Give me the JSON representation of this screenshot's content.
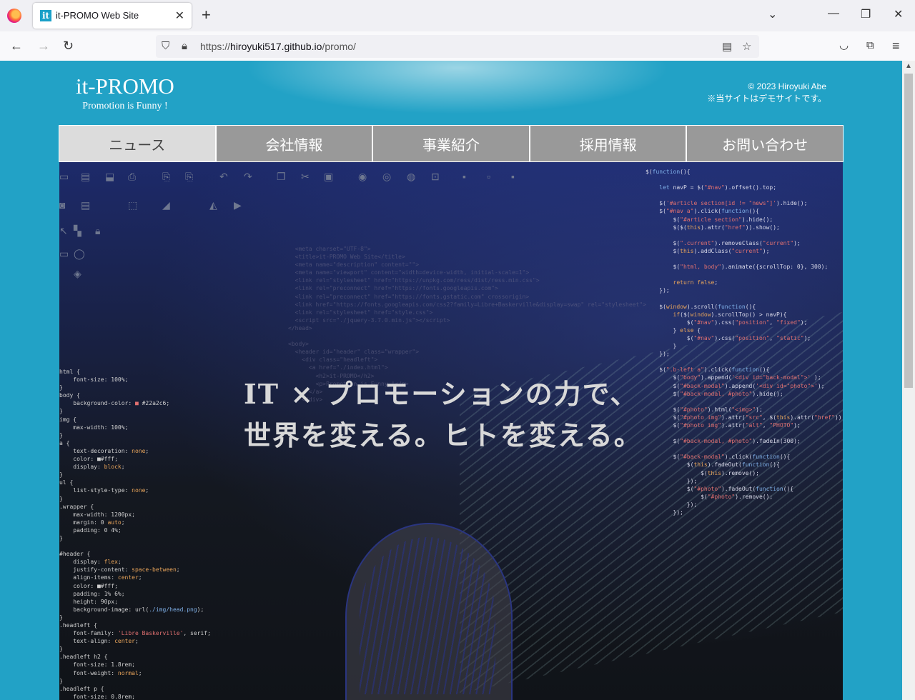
{
  "browser": {
    "tab_title": "it-PROMO Web Site",
    "tab_favicon": "it",
    "url_scheme": "https://",
    "url_host": "hiroyuki517.github.io",
    "url_path": "/promo/",
    "icons": {
      "back": "arrow-left-icon",
      "forward": "arrow-right-icon",
      "reload": "reload-icon",
      "shield": "shield-icon",
      "lock": "lock-icon",
      "reader": "reader-view-icon",
      "bookmark": "star-icon",
      "pocket": "pocket-icon",
      "extensions": "extensions-icon",
      "menu": "hamburger-menu-icon"
    }
  },
  "header": {
    "logo_title": "it-PROMO",
    "logo_subtitle": "Promotion is Funny !",
    "copyright": "© 2023 Hiroyuki Abe",
    "notice": "※当サイトはデモサイトです。"
  },
  "nav": {
    "items": [
      {
        "label": "ニュース",
        "current": true
      },
      {
        "label": "会社情報",
        "current": false
      },
      {
        "label": "事業紹介",
        "current": false
      },
      {
        "label": "採用情報",
        "current": false
      },
      {
        "label": "お問い合わせ",
        "current": false
      }
    ]
  },
  "hero": {
    "line1": "IT × プロモーションの力で、",
    "line2": "世界を変える。ヒトを変える。"
  },
  "colors": {
    "page_bg": "#22a2c6",
    "nav_bg": "#999999",
    "nav_current_bg": "#dcdcdc"
  }
}
